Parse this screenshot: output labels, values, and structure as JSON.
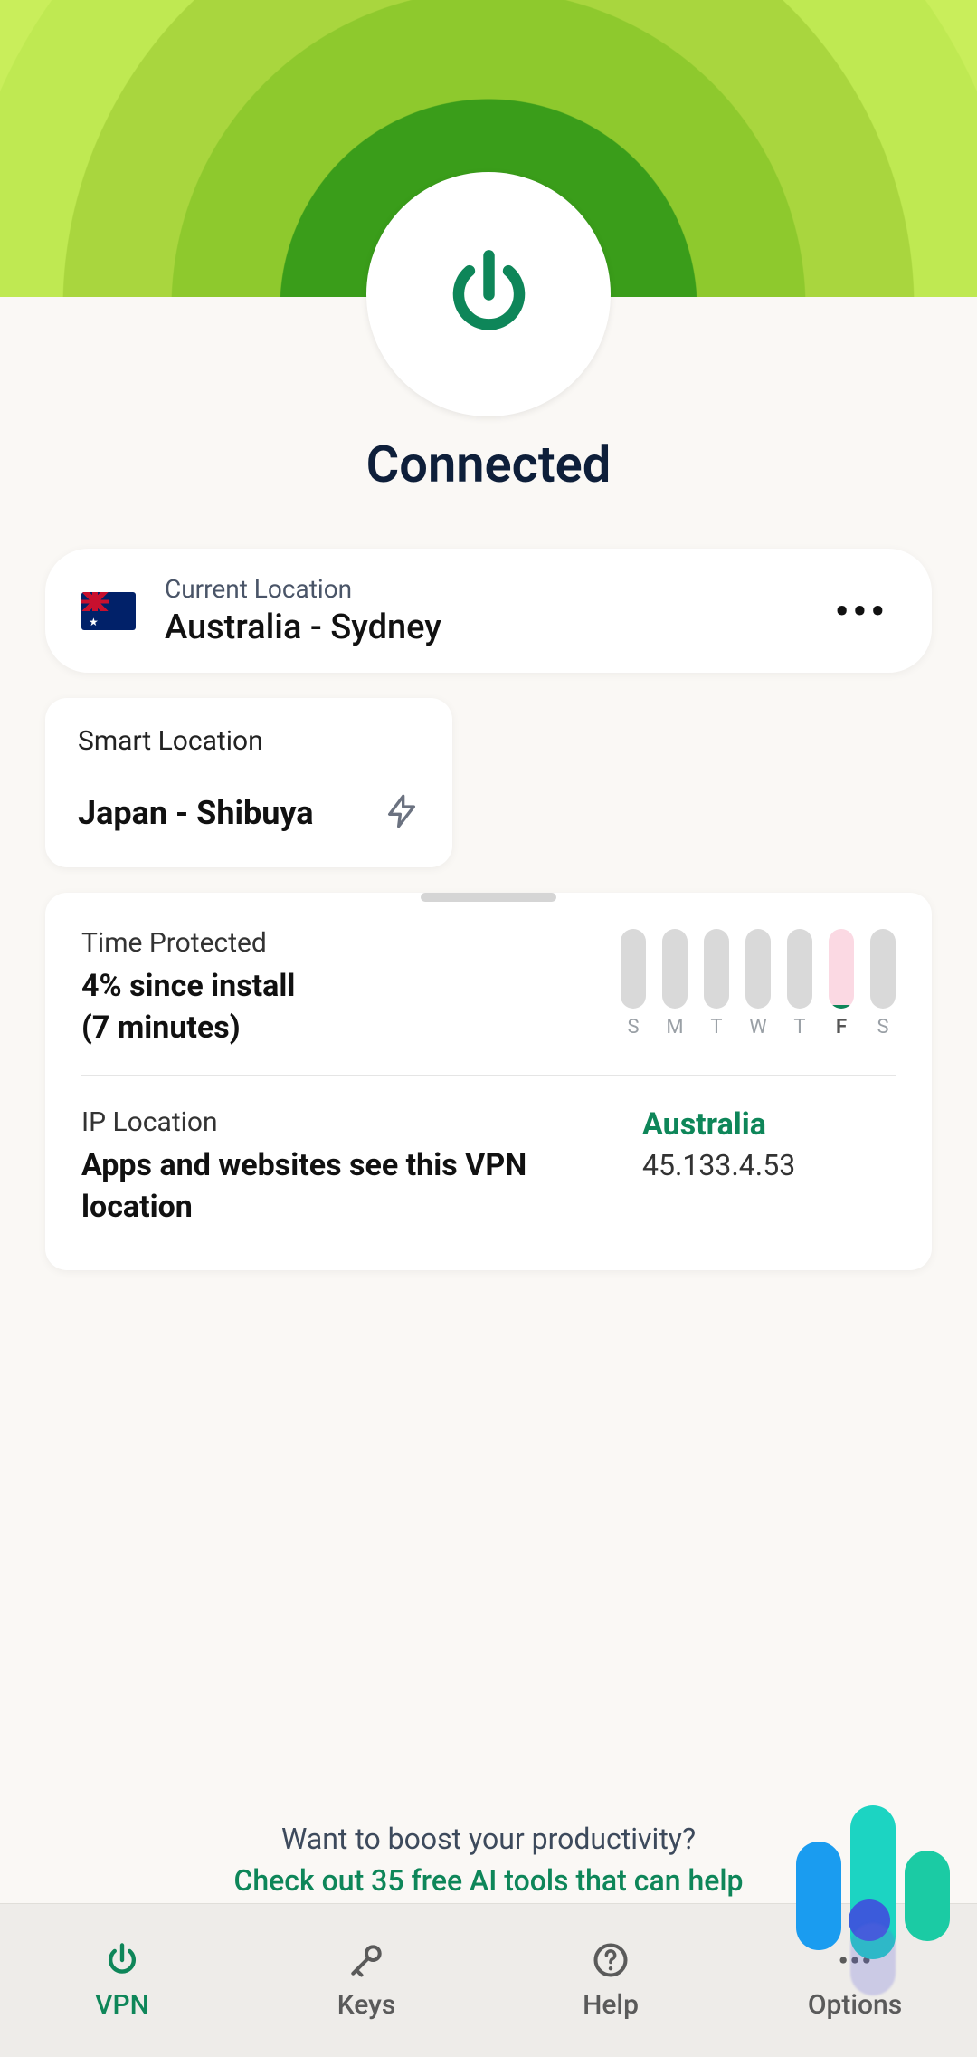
{
  "status": "Connected",
  "current_location": {
    "label": "Current Location",
    "value": "Australia - Sydney",
    "flag": "australia"
  },
  "smart_location": {
    "label": "Smart Location",
    "value": "Japan - Shibuya"
  },
  "time_protected": {
    "title": "Time Protected",
    "line1": "4% since install",
    "line2": "(7 minutes)",
    "days": [
      {
        "label": "S",
        "fill_pct": 0,
        "today": false
      },
      {
        "label": "M",
        "fill_pct": 0,
        "today": false
      },
      {
        "label": "T",
        "fill_pct": 0,
        "today": false
      },
      {
        "label": "W",
        "fill_pct": 0,
        "today": false
      },
      {
        "label": "T",
        "fill_pct": 0,
        "today": false
      },
      {
        "label": "F",
        "fill_pct": 4,
        "today": true
      },
      {
        "label": "S",
        "fill_pct": 0,
        "today": false
      }
    ]
  },
  "ip_location": {
    "title": "IP Location",
    "desc": "Apps and websites see this VPN location",
    "country": "Australia",
    "ip": "45.133.4.53"
  },
  "promo": {
    "line1": "Want to boost your productivity?",
    "line2": "Check out 35 free AI tools that can help"
  },
  "nav": {
    "vpn": "VPN",
    "keys": "Keys",
    "help": "Help",
    "options": "Options"
  },
  "colors": {
    "accent_green": "#0e8659",
    "header_green": "#8ec92d"
  }
}
